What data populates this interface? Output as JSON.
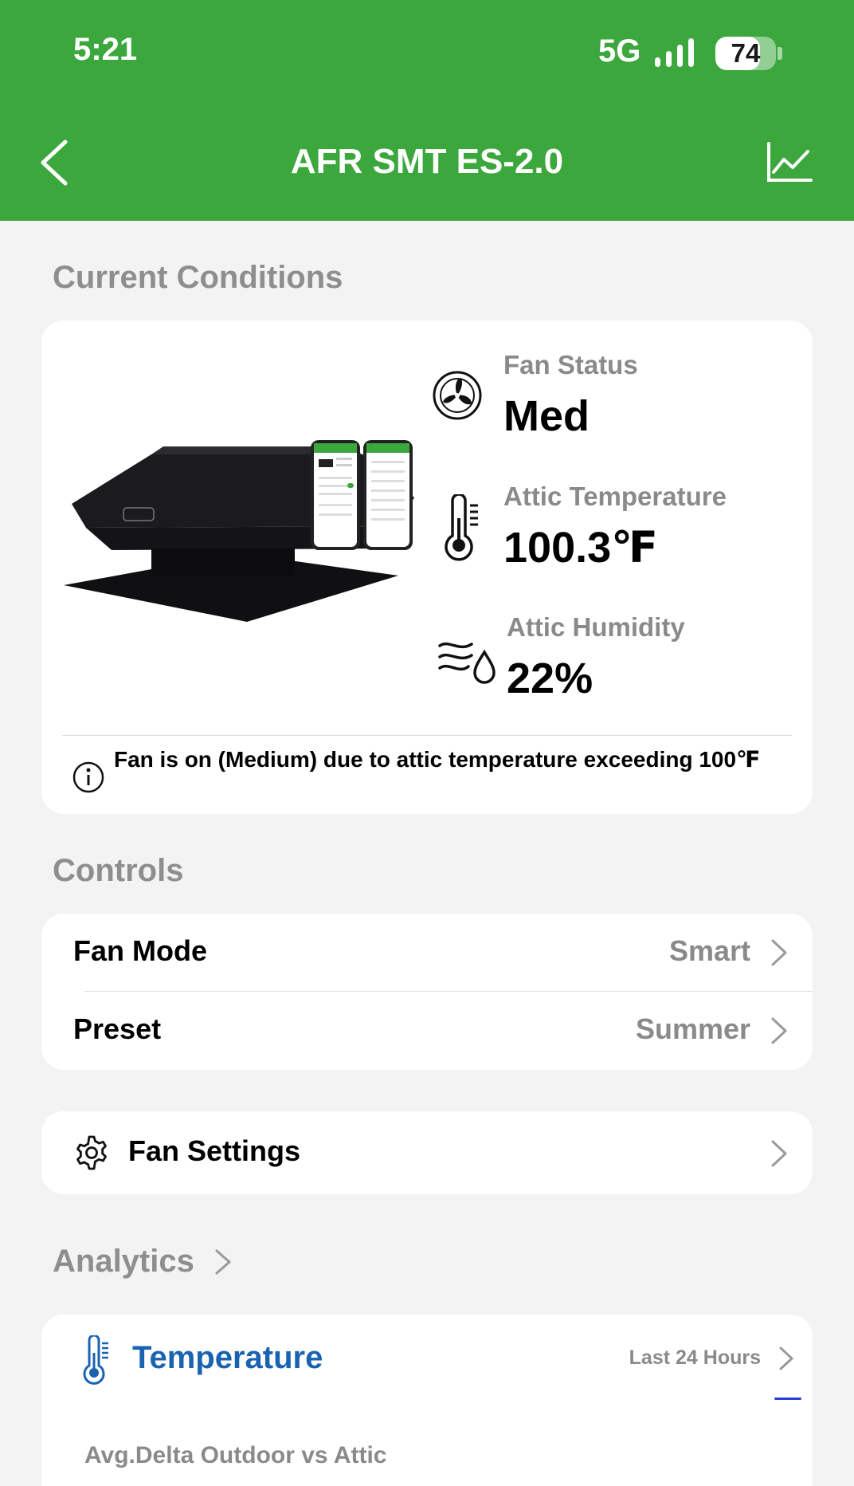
{
  "status_bar": {
    "time": "5:21",
    "network": "5G",
    "battery": 74
  },
  "header": {
    "title": "AFR SMT ES-2.0",
    "back_icon": "back-chevron-icon",
    "chart_icon": "line-chart-icon"
  },
  "current_conditions": {
    "title": "Current Conditions",
    "fan_status": {
      "label": "Fan Status",
      "value": "Med",
      "icon": "fan-icon"
    },
    "attic_temperature": {
      "label": "Attic Temperature",
      "value": "100.3℉",
      "icon": "thermometer-icon"
    },
    "attic_humidity": {
      "label": "Attic Humidity",
      "value": "22%",
      "icon": "humidity-icon"
    },
    "info": "Fan is on (Medium) due to attic temperature exceeding 100℉"
  },
  "controls": {
    "title": "Controls",
    "fan_mode": {
      "label": "Fan Mode",
      "value": "Smart"
    },
    "preset": {
      "label": "Preset",
      "value": "Summer"
    }
  },
  "fan_settings": {
    "label": "Fan Settings",
    "icon": "gear-icon"
  },
  "analytics": {
    "title": "Analytics",
    "temperature": {
      "title": "Temperature",
      "range": "Last 24 Hours",
      "subtitle": "Avg.Delta Outdoor vs Attic"
    }
  },
  "colors": {
    "header_green": "#3ba73c",
    "temp_blue": "#1a63b0"
  }
}
